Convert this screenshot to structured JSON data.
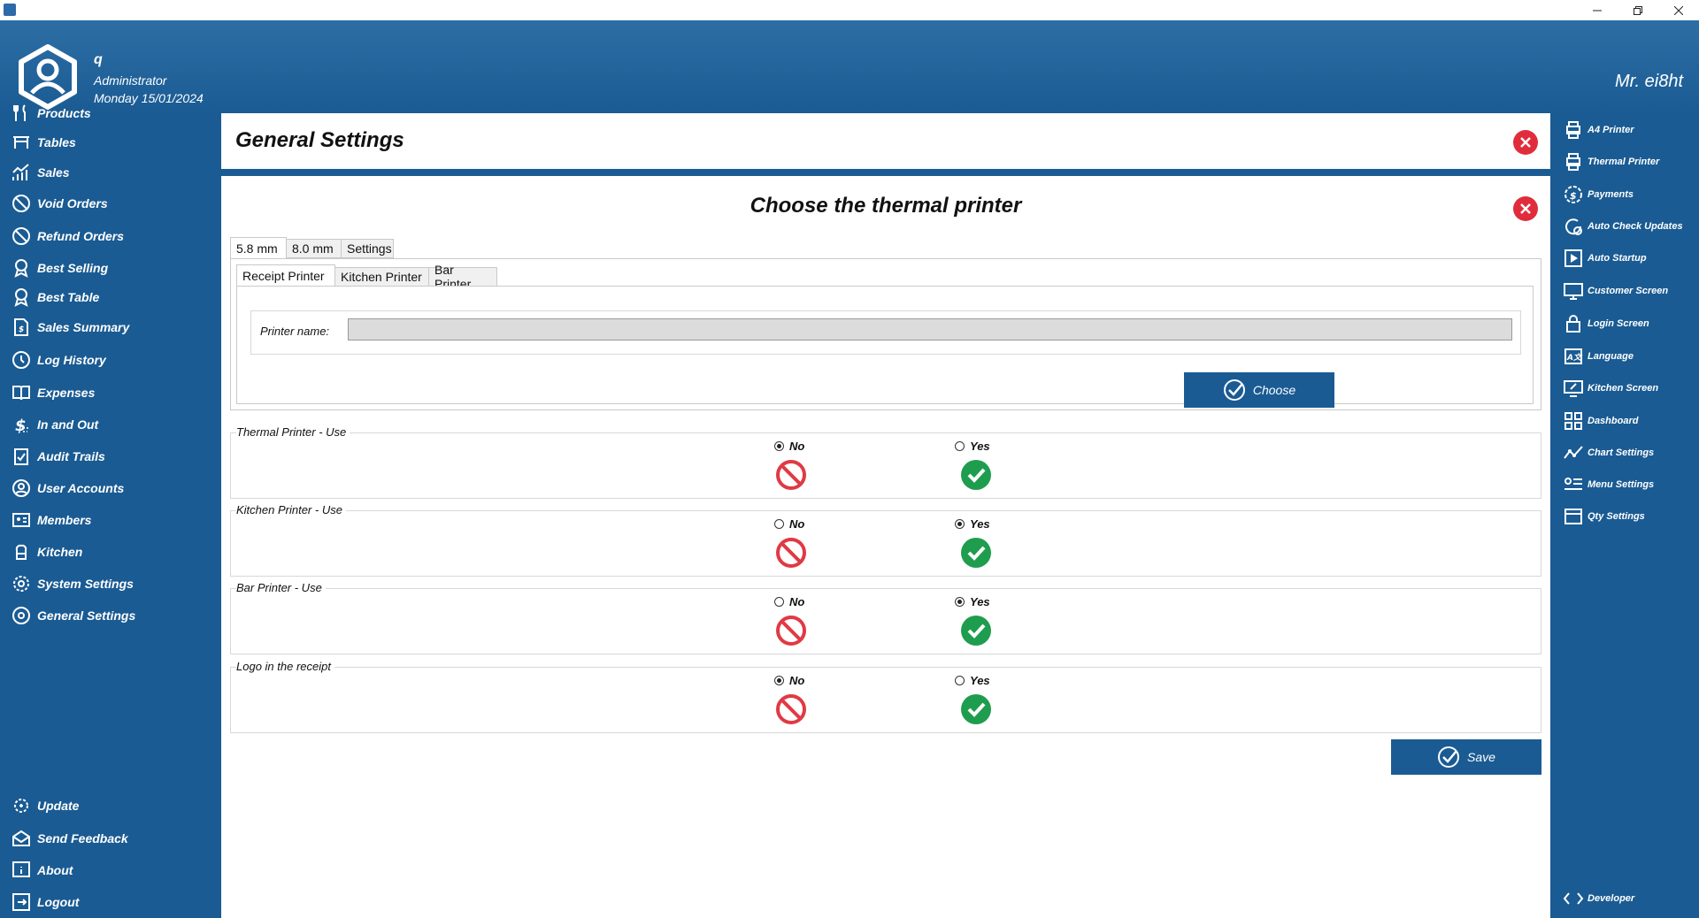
{
  "header": {
    "user_name": "q",
    "user_role": "Administrator",
    "user_date": "Monday 15/01/2024",
    "brand": "Mr. ei8ht"
  },
  "left_nav": [
    {
      "label": "Products",
      "icon": "utensils-icon"
    },
    {
      "label": "Tables",
      "icon": "table-icon"
    },
    {
      "label": "Sales",
      "icon": "chart-icon"
    },
    {
      "label": "Void Orders",
      "icon": "ban-icon"
    },
    {
      "label": "Refund Orders",
      "icon": "ban-icon"
    },
    {
      "label": "Best Selling",
      "icon": "award-icon"
    },
    {
      "label": "Best Table",
      "icon": "award-icon"
    },
    {
      "label": "Sales Summary",
      "icon": "document-dollar-icon"
    },
    {
      "label": "Log History",
      "icon": "history-icon"
    },
    {
      "label": "Expenses",
      "icon": "book-icon"
    },
    {
      "label": "In and Out",
      "icon": "dollar-icon"
    },
    {
      "label": "Audit Trails",
      "icon": "clipboard-check-icon"
    },
    {
      "label": "User Accounts",
      "icon": "user-circle-icon"
    },
    {
      "label": "Members",
      "icon": "id-card-icon"
    },
    {
      "label": "Kitchen",
      "icon": "chef-icon"
    },
    {
      "label": "System Settings",
      "icon": "gear-icon"
    },
    {
      "label": "General Settings",
      "icon": "settings-circle-icon"
    }
  ],
  "left_bottom_nav": [
    {
      "label": "Update",
      "icon": "update-gear-icon"
    },
    {
      "label": "Send Feedback",
      "icon": "mail-icon"
    },
    {
      "label": "About",
      "icon": "info-icon"
    },
    {
      "label": "Logout",
      "icon": "logout-icon"
    }
  ],
  "right_nav": [
    {
      "label": "A4 Printer",
      "icon": "printer-icon"
    },
    {
      "label": "Thermal Printer",
      "icon": "printer-icon"
    },
    {
      "label": "Payments",
      "icon": "payment-icon"
    },
    {
      "label": "Auto Check Updates",
      "icon": "refresh-check-icon"
    },
    {
      "label": "Auto Startup",
      "icon": "play-icon"
    },
    {
      "label": "Customer Screen",
      "icon": "monitor-user-icon"
    },
    {
      "label": "Login Screen",
      "icon": "lock-icon"
    },
    {
      "label": "Language",
      "icon": "language-icon"
    },
    {
      "label": "Kitchen Screen",
      "icon": "monitor-edit-icon"
    },
    {
      "label": "Dashboard",
      "icon": "dashboard-icon"
    },
    {
      "label": "Chart Settings",
      "icon": "line-chart-icon"
    },
    {
      "label": "Menu Settings",
      "icon": "menu-user-icon"
    },
    {
      "label": "Qty Settings",
      "icon": "window-icon"
    }
  ],
  "right_bottom_nav": {
    "label": "Developer",
    "icon": "code-icon"
  },
  "main": {
    "title": "General Settings",
    "panel_title": "Choose the thermal printer",
    "size_tabs": [
      "5.8 mm",
      "8.0 mm",
      "Settings"
    ],
    "printer_tabs": [
      "Receipt Printer",
      "Kitchen Printer",
      "Bar Printer"
    ],
    "printer_name_label": "Printer name:",
    "printer_name_value": "",
    "choose_label": "Choose",
    "save_label": "Save"
  },
  "options": [
    {
      "label": "Thermal Printer - Use",
      "selected": "No"
    },
    {
      "label": "Kitchen Printer - Use",
      "selected": "Yes"
    },
    {
      "label": "Bar Printer - Use",
      "selected": "Yes"
    },
    {
      "label": "Logo in the receipt",
      "selected": "No"
    }
  ],
  "radio_labels": {
    "no": "No",
    "yes": "Yes"
  },
  "colors": {
    "primary": "#1a5b93",
    "close_red": "#e02d3c",
    "yes_green": "#1f9d4e",
    "no_red": "#e03a45"
  }
}
